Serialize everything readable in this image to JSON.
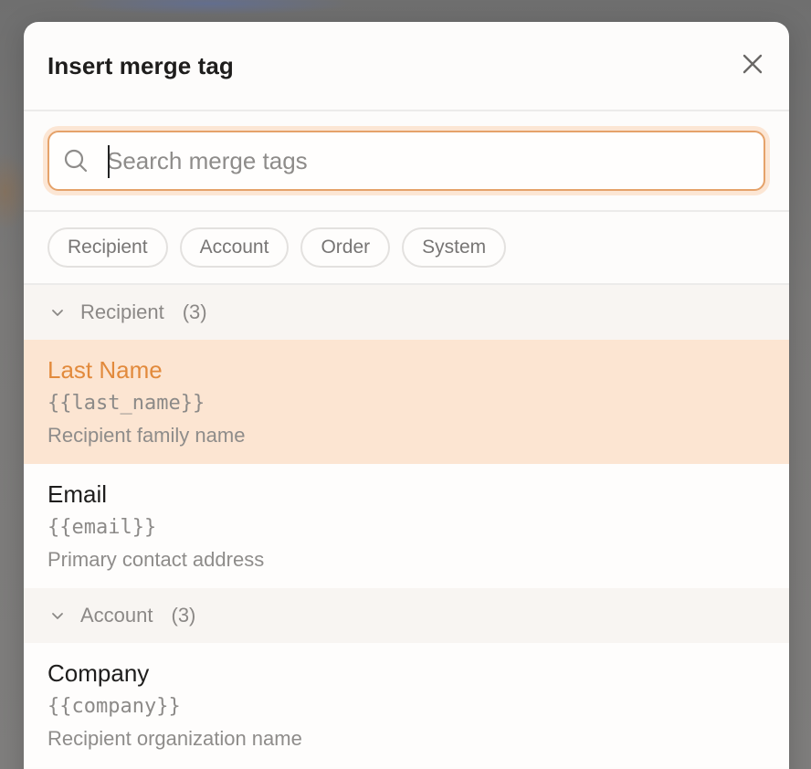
{
  "modal": {
    "title": "Insert merge tag"
  },
  "search": {
    "placeholder": "Search merge tags",
    "value": ""
  },
  "filters": [
    {
      "label": "Recipient"
    },
    {
      "label": "Account"
    },
    {
      "label": "Order"
    },
    {
      "label": "System"
    }
  ],
  "groups": [
    {
      "name": "Recipient",
      "count": "(3)",
      "expanded": true,
      "items": [
        {
          "name": "Last Name",
          "code": "{{last_name}}",
          "description": "Recipient family name",
          "selected": true
        },
        {
          "name": "Email",
          "code": "{{email}}",
          "description": "Primary contact address",
          "selected": false
        }
      ]
    },
    {
      "name": "Account",
      "count": "(3)",
      "expanded": true,
      "items": [
        {
          "name": "Company",
          "code": "{{company}}",
          "description": "Recipient organization name",
          "selected": false
        }
      ]
    }
  ],
  "colors": {
    "accent": "#e28a3c",
    "selected_bg": "#fce5d2",
    "focus_ring": "#e5a26a"
  },
  "icons": {
    "close": "close-icon",
    "search": "search-icon",
    "chevron": "chevron-down-icon"
  }
}
